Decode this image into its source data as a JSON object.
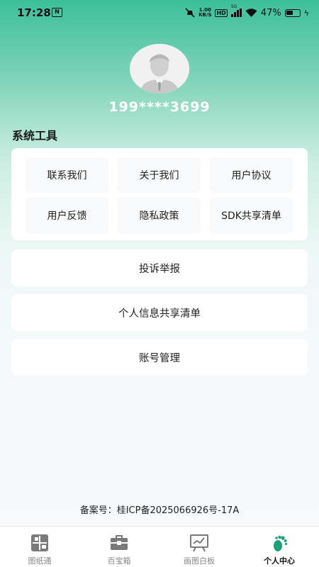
{
  "status_bar": {
    "time": "17:28",
    "notification_badge": "N",
    "speed_value": "1.00",
    "speed_unit": "KB/S",
    "hd_label": "HD",
    "signal_label": "5G",
    "battery": "47%"
  },
  "profile": {
    "phone_masked": "199****3699"
  },
  "tools": {
    "title": "系统工具",
    "items": [
      "联系我们",
      "关于我们",
      "用户协议",
      "用户反馈",
      "隐私政策",
      "SDK共享清单"
    ]
  },
  "rows": {
    "complaint": "投诉举报",
    "info_sharing": "个人信息共享清单",
    "account": "账号管理"
  },
  "footer": {
    "icp": "备案号：桂ICP备2025066926号-17A"
  },
  "tab_bar": {
    "active": 3,
    "active_color": "#1f9e7a",
    "inactive_color": "#888888",
    "items": [
      {
        "label": "图纸通",
        "icon": "blueprint-icon"
      },
      {
        "label": "百宝箱",
        "icon": "toolbox-icon"
      },
      {
        "label": "画图白板",
        "icon": "whiteboard-icon"
      },
      {
        "label": "个人中心",
        "icon": "footprint-icon"
      }
    ]
  }
}
